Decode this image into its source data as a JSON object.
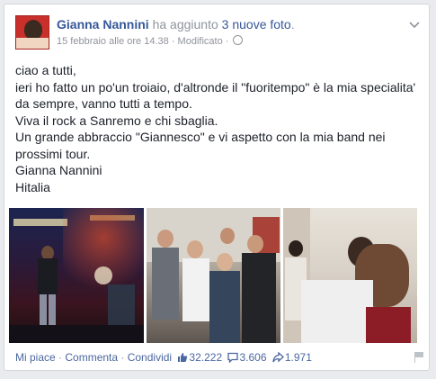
{
  "post": {
    "author": "Gianna Nannini",
    "action_prefix": "ha aggiunto",
    "action_link": "3 nuove foto",
    "action_suffix": ".",
    "timestamp": "15 febbraio alle ore 14.38",
    "edited": "Modificato",
    "separator": " · ",
    "privacy_icon": "globe-icon",
    "menu_icon": "chevron-down-icon",
    "lines": [
      "ciao a tutti,",
      "ieri ho fatto un po'un troiaio, d'altronde il \"fuoritempo\" è la mia specialita' da sempre, vanno tutti a tempo.",
      "Viva il rock a Sanremo e chi sbaglia.",
      "Un grande abbraccio \"Giannesco\" e vi aspetto con la mia band nei prossimi tour.",
      "Gianna Nannini",
      "Hitalia"
    ]
  },
  "actions": {
    "like": "Mi piace",
    "comment": "Commenta",
    "share": "Condividi",
    "dot": " · ",
    "like_count": "32.222",
    "comment_count": "3.606",
    "share_count": "1.971",
    "like_icon": "thumbs-up-icon",
    "comment_icon": "comment-bubble-icon",
    "share_icon": "share-arrow-icon",
    "flag_icon": "flag-icon"
  },
  "colors": {
    "link": "#365899",
    "meta": "#90949c",
    "text": "#1d2129",
    "action_link": "#4b67a1"
  }
}
